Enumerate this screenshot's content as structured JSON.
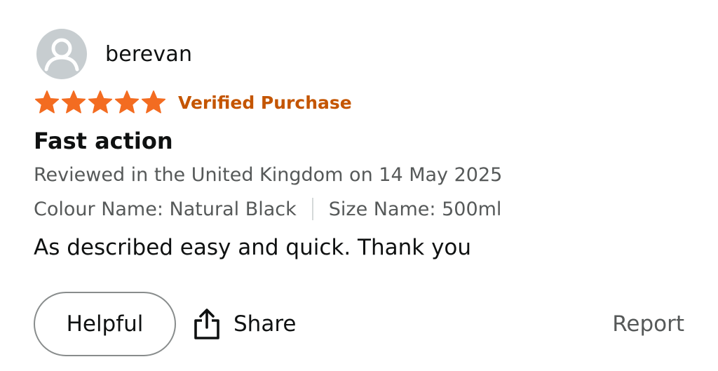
{
  "review": {
    "username": "berevan",
    "rating": 5,
    "rating_max": 5,
    "verified_label": "Verified Purchase",
    "title": "Fast action",
    "reviewed_line": "Reviewed in the United Kingdom on 14 May 2025",
    "colour": "Colour Name: Natural Black",
    "size": "Size Name: 500ml",
    "body": "As described easy and quick. Thank you"
  },
  "actions": {
    "helpful_label": "Helpful",
    "share_label": "Share",
    "report_label": "Report"
  },
  "colors": {
    "star": "#f36c21",
    "verified": "#c45500",
    "avatar_bg": "#c7cdd0",
    "secondary_text": "#565959"
  },
  "icons": {
    "avatar": "user-silhouette-icon",
    "star": "star-icon",
    "share": "share-icon"
  }
}
